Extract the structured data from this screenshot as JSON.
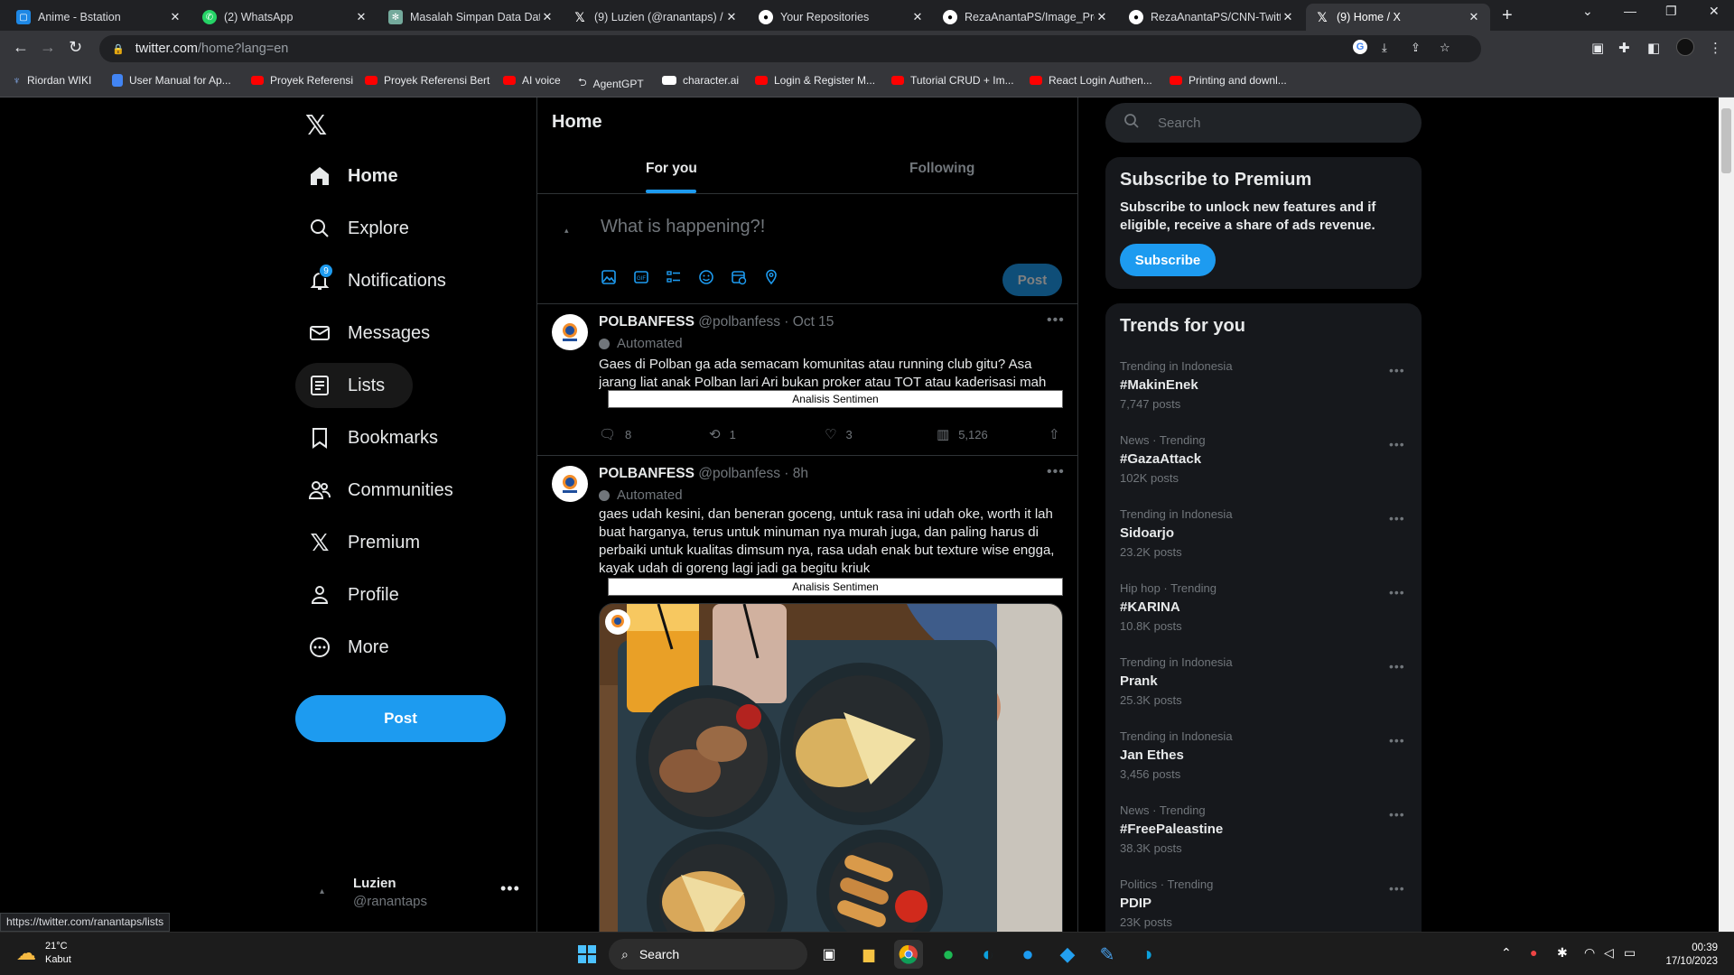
{
  "browser": {
    "tabs": [
      {
        "title": "Anime - Bstation",
        "icon": "bstation-icon",
        "color": "#1e88e5"
      },
      {
        "title": "(2) WhatsApp",
        "icon": "whatsapp-icon",
        "color": "#25d366"
      },
      {
        "title": "Masalah Simpan Data Dat",
        "icon": "chatgpt-icon",
        "color": "#74aa9c"
      },
      {
        "title": "(9) Luzien (@ranantaps) /",
        "icon": "x-icon",
        "color": "#000000"
      },
      {
        "title": "Your Repositories",
        "icon": "github-icon",
        "color": "#24292e"
      },
      {
        "title": "RezaAnantaPS/Image_Pro",
        "icon": "github-icon",
        "color": "#24292e"
      },
      {
        "title": "RezaAnantaPS/CNN-Twitt",
        "icon": "github-icon",
        "color": "#24292e"
      },
      {
        "title": "(9) Home / X",
        "icon": "x-icon",
        "color": "#000000"
      }
    ],
    "url_host": "twitter.com",
    "url_path": "/home?lang=en",
    "bookmarks": [
      {
        "label": "Riordan WIKI",
        "icon": "wiki-icon"
      },
      {
        "label": "User Manual for Ap...",
        "icon": "docs-icon"
      },
      {
        "label": "Proyek Referensi",
        "icon": "youtube-icon"
      },
      {
        "label": "Proyek Referensi Bert",
        "icon": "youtube-icon"
      },
      {
        "label": "AI voice",
        "icon": "youtube-icon"
      },
      {
        "label": "AgentGPT",
        "icon": "agentgpt-icon"
      },
      {
        "label": "character.ai",
        "icon": "characterai-icon"
      },
      {
        "label": "Login & Register M...",
        "icon": "youtube-icon"
      },
      {
        "label": "Tutorial CRUD + Im...",
        "icon": "youtube-icon"
      },
      {
        "label": "React Login Authen...",
        "icon": "youtube-icon"
      },
      {
        "label": "Printing and downl...",
        "icon": "youtube-icon"
      }
    ],
    "status_url": "https://twitter.com/ranantaps/lists"
  },
  "nav": {
    "items": [
      {
        "label": "Home",
        "icon": "home-icon"
      },
      {
        "label": "Explore",
        "icon": "search-icon"
      },
      {
        "label": "Notifications",
        "icon": "bell-icon",
        "badge": "9"
      },
      {
        "label": "Messages",
        "icon": "mail-icon"
      },
      {
        "label": "Lists",
        "icon": "list-icon"
      },
      {
        "label": "Bookmarks",
        "icon": "bookmark-icon"
      },
      {
        "label": "Communities",
        "icon": "people-icon"
      },
      {
        "label": "Premium",
        "icon": "x-icon"
      },
      {
        "label": "Profile",
        "icon": "person-icon"
      },
      {
        "label": "More",
        "icon": "more-circle-icon"
      }
    ],
    "post_label": "Post",
    "account": {
      "name": "Luzien",
      "handle": "@ranantaps"
    }
  },
  "main": {
    "title": "Home",
    "tabs": [
      {
        "label": "For you"
      },
      {
        "label": "Following"
      }
    ],
    "compose_placeholder": "What is happening?!",
    "post_label": "Post",
    "tweets": [
      {
        "name": "POLBANFESS",
        "handle": "@polbanfess",
        "time": "Oct 15",
        "automated": "Automated",
        "text": "Gaes di Polban ga ada semacam komunitas atau running club gitu? Asa jarang liat anak Polban lari Ari bukan proker atau TOT atau kaderisasi mah",
        "sentiment_label": "Analisis Sentimen",
        "replies": "8",
        "reposts": "1",
        "likes": "3",
        "views": "5,126"
      },
      {
        "name": "POLBANFESS",
        "handle": "@polbanfess",
        "time": "8h",
        "automated": "Automated",
        "text": "gaes udah kesini, dan beneran goceng, untuk rasa ini udah oke, worth it lah buat harganya, terus untuk minuman nya murah juga, dan paling harus di perbaiki untuk kualitas dimsum nya, rasa udah enak but texture wise engga, kayak udah di goreng lagi jadi ga begitu kriuk",
        "sentiment_label": "Analisis Sentimen"
      }
    ]
  },
  "right": {
    "search_placeholder": "Search",
    "premium": {
      "title": "Subscribe to Premium",
      "text": "Subscribe to unlock new features and if eligible, receive a share of ads revenue.",
      "button": "Subscribe"
    },
    "trends_title": "Trends for you",
    "trends": [
      {
        "context": "Trending in Indonesia",
        "name": "#MakinEnek",
        "posts": "7,747 posts"
      },
      {
        "context": "News · Trending",
        "name": "#GazaAttack",
        "posts": "102K posts"
      },
      {
        "context": "Trending in Indonesia",
        "name": "Sidoarjo",
        "posts": "23.2K posts"
      },
      {
        "context": "Hip hop · Trending",
        "name": "#KARINA",
        "posts": "10.8K posts"
      },
      {
        "context": "Trending in Indonesia",
        "name": "Prank",
        "posts": "25.3K posts"
      },
      {
        "context": "Trending in Indonesia",
        "name": "Jan Ethes",
        "posts": "3,456 posts"
      },
      {
        "context": "News · Trending",
        "name": "#FreePaleastine",
        "posts": "38.3K posts"
      },
      {
        "context": "Politics · Trending",
        "name": "PDIP",
        "posts": "23K posts"
      }
    ]
  },
  "taskbar": {
    "weather_temp": "21°C",
    "weather_desc": "Kabut",
    "search_label": "Search",
    "time": "00:39",
    "date": "17/10/2023"
  },
  "colors": {
    "accent": "#1d9bf0",
    "background": "#000000",
    "card": "#16181c",
    "muted": "#71767b"
  }
}
